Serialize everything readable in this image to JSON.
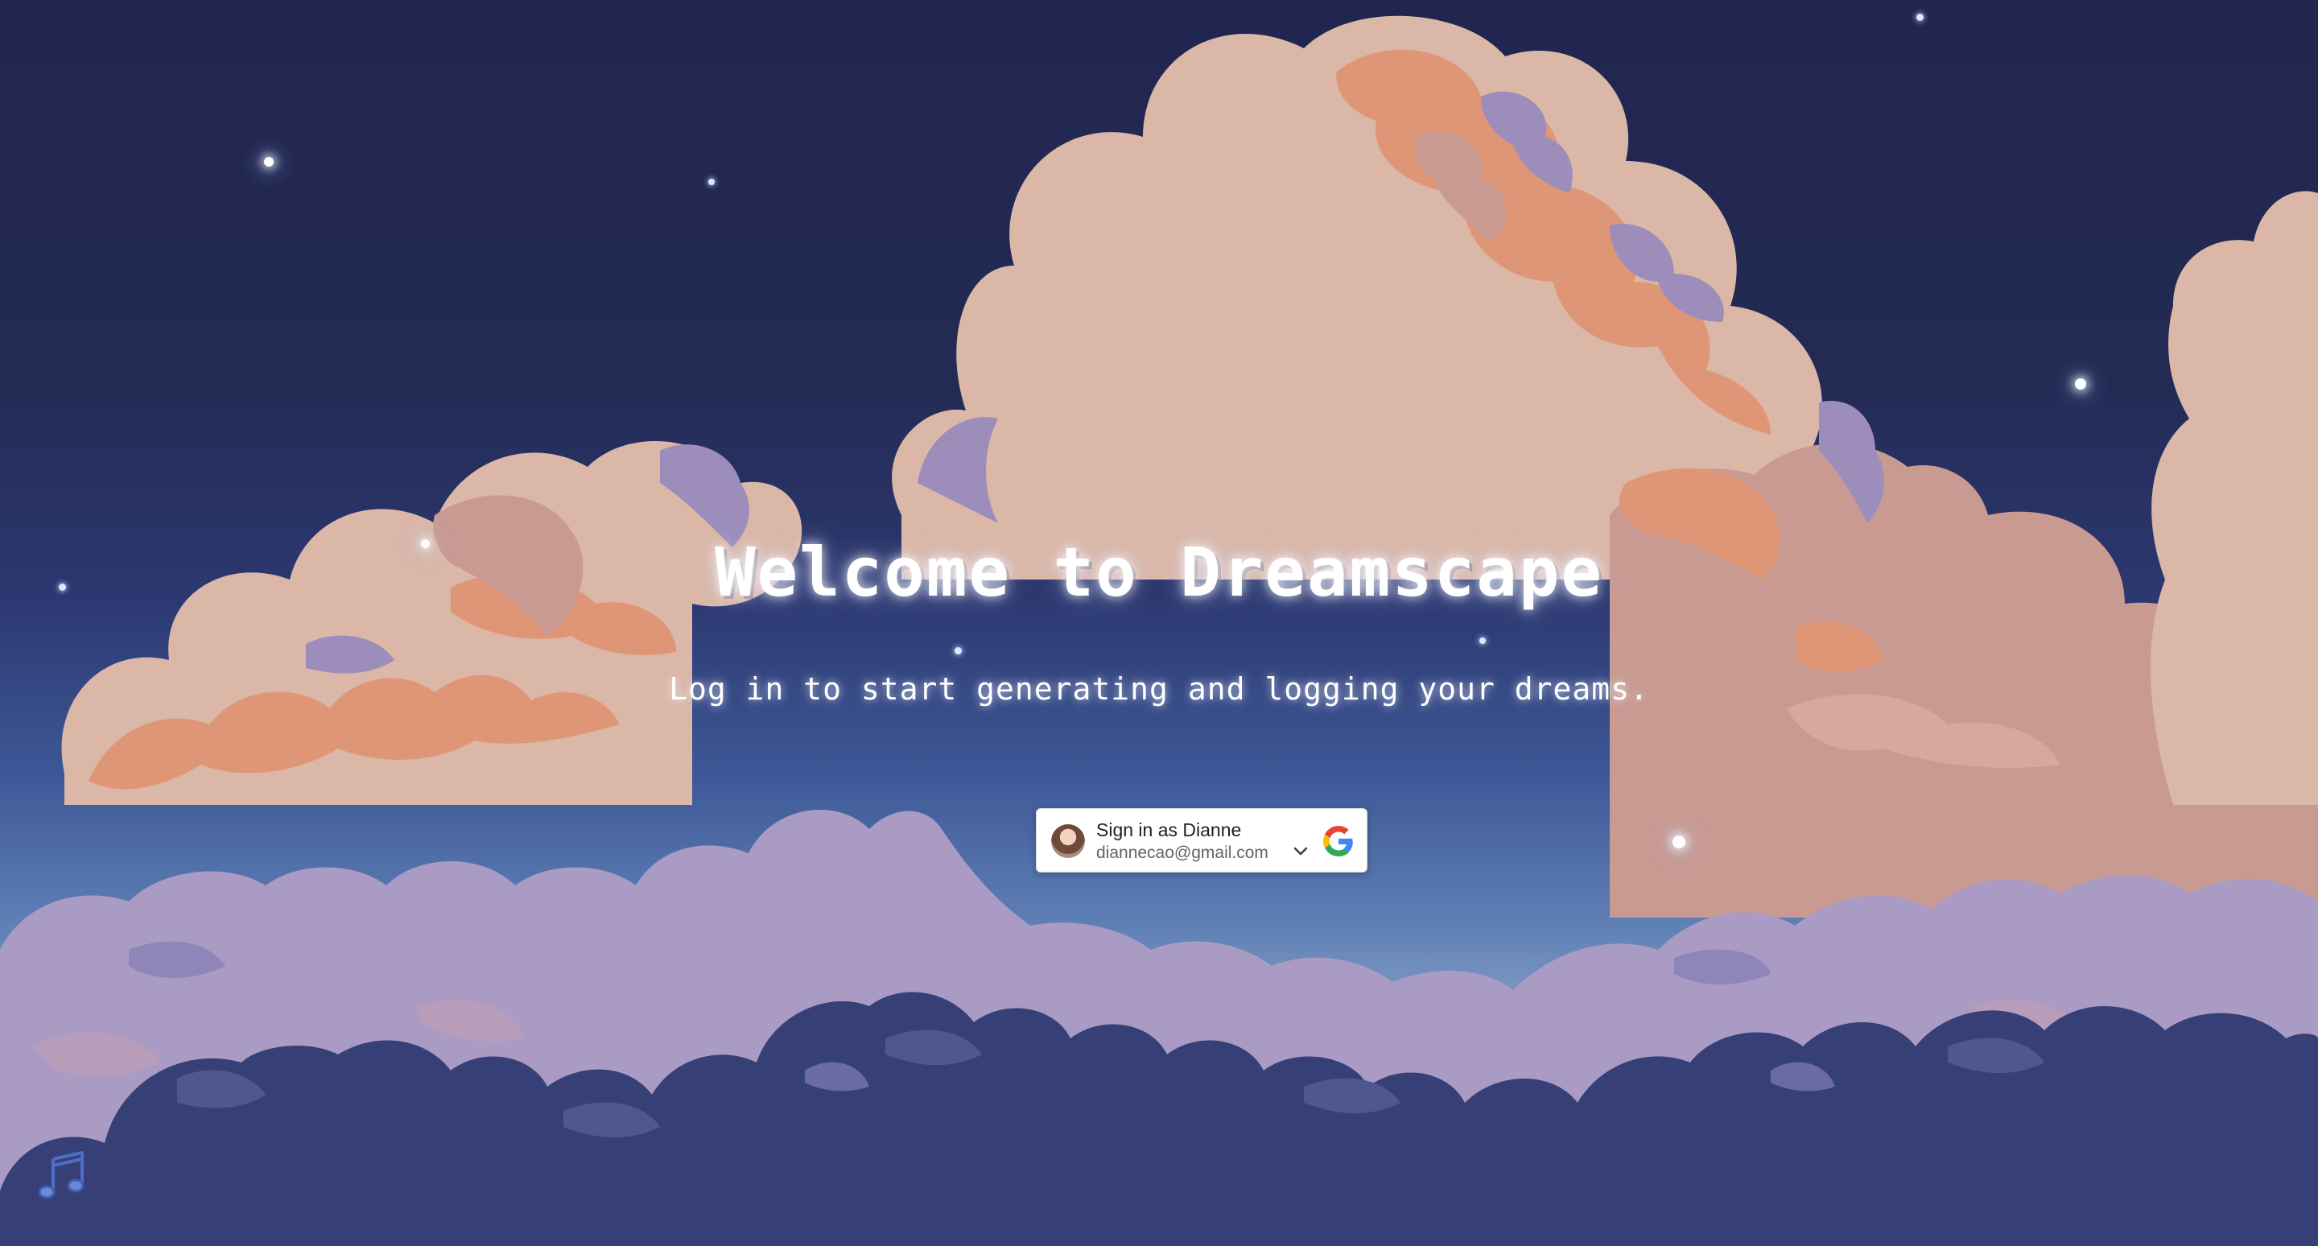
{
  "page": {
    "title": "Welcome to Dreamscape",
    "subtitle": "Log in to start generating and logging your dreams."
  },
  "signin": {
    "label": "Sign in as Dianne",
    "email": "diannecao@gmail.com",
    "avatar_icon": "user-avatar-icon",
    "chevron_icon": "chevron-down-icon",
    "logo_icon": "google-logo-icon"
  },
  "music": {
    "icon": "music-note-icon"
  },
  "colors": {
    "sky_top": "#212650",
    "sky_bottom": "#8fa6c9",
    "cloud_peach": "#dbb7a8",
    "cloud_orange": "#df9676",
    "cloud_lavender": "#9c8dbb",
    "cloud_navy": "#373f77",
    "title_text": "#ffffff"
  }
}
